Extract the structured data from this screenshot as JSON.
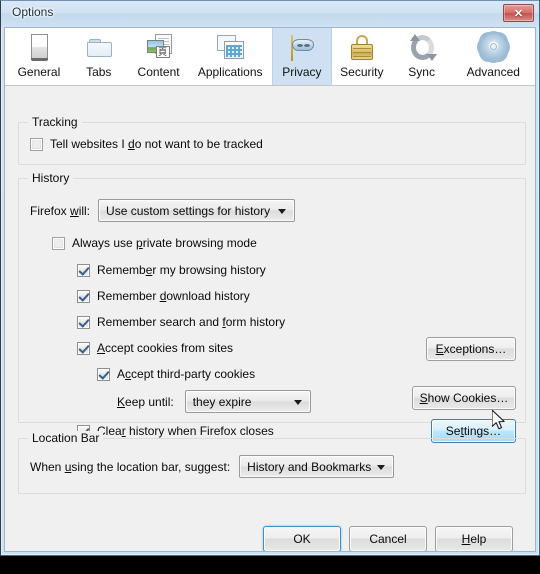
{
  "window": {
    "title": "Options",
    "close_label": "✕",
    "close_icon": "close-icon"
  },
  "tabs": [
    {
      "id": "general",
      "label": "General",
      "icon": "general-page-icon",
      "selected": false
    },
    {
      "id": "tabs",
      "label": "Tabs",
      "icon": "folder-tabs-icon",
      "selected": false
    },
    {
      "id": "content",
      "label": "Content",
      "icon": "content-image-page-icon",
      "selected": false
    },
    {
      "id": "applications",
      "label": "Applications",
      "icon": "applications-grid-icon",
      "selected": false
    },
    {
      "id": "privacy",
      "label": "Privacy",
      "icon": "privacy-mask-icon",
      "selected": true
    },
    {
      "id": "security",
      "label": "Security",
      "icon": "padlock-icon",
      "selected": false
    },
    {
      "id": "sync",
      "label": "Sync",
      "icon": "sync-arrows-icon",
      "selected": false
    },
    {
      "id": "advanced",
      "label": "Advanced",
      "icon": "gear-icon",
      "selected": false
    }
  ],
  "tracking": {
    "legend": "Tracking",
    "do_not_track": {
      "label_before": "Tell websites I ",
      "label_accel": "d",
      "label_after": "o not want to be tracked",
      "checked": false
    }
  },
  "history": {
    "legend": "History",
    "firefox_will": {
      "label_before": "Firefox ",
      "label_accel": "w",
      "label_after": "ill:",
      "value": "Use custom settings for history"
    },
    "always_private": {
      "label_before": "Always use ",
      "label_accel": "p",
      "label_after": "rivate browsing mode",
      "checked": false
    },
    "remember_browsing": {
      "label_before": "Rememb",
      "label_accel": "e",
      "label_after": "r my browsing history",
      "checked": true
    },
    "remember_downloads": {
      "label_before": "Remember ",
      "label_accel": "d",
      "label_after": "ownload history",
      "checked": true
    },
    "remember_search_form": {
      "label_before": "Remember search and ",
      "label_accel": "f",
      "label_after": "orm history",
      "checked": true
    },
    "accept_cookies": {
      "label_before": "",
      "label_accel": "A",
      "label_after": "ccept cookies from sites",
      "checked": true
    },
    "accept_third_party": {
      "label_before": "A",
      "label_accel": "c",
      "label_after": "cept third-party cookies",
      "checked": true
    },
    "keep_until": {
      "label_accel": "K",
      "label_after": "eep until:",
      "value": "they expire"
    },
    "clear_on_close": {
      "label_before": "Clea",
      "label_accel": "r",
      "label_after": " history when Firefox closes",
      "checked": true
    },
    "exceptions_button": {
      "label_accel": "E",
      "label_after": "xceptions…"
    },
    "show_cookies_button": {
      "label_accel": "S",
      "label_after": "how Cookies…"
    },
    "settings_button": {
      "label_before": "Se",
      "label_accel": "t",
      "label_after": "tings…",
      "state": "hover"
    }
  },
  "location_bar": {
    "legend": "Location Bar",
    "suggest": {
      "label_before": "When ",
      "label_accel": "u",
      "label_after": "sing the location bar, suggest:",
      "value": "History and Bookmarks"
    }
  },
  "footer": {
    "ok": {
      "label": "OK",
      "state": "default"
    },
    "cancel": {
      "label": "Cancel"
    },
    "help": {
      "label_accel": "H",
      "label_after": "elp"
    }
  },
  "cursor": {
    "icon": "mouse-pointer-icon"
  },
  "colors": {
    "accent": "#2c95d4",
    "tab_selected_bg": "#cfe0f2",
    "dialog_bg": "#f0f0f0",
    "titlebar_bg": "#cfe1f2",
    "close_red": "#c4504c",
    "hover_blue": "#bee6fd"
  }
}
